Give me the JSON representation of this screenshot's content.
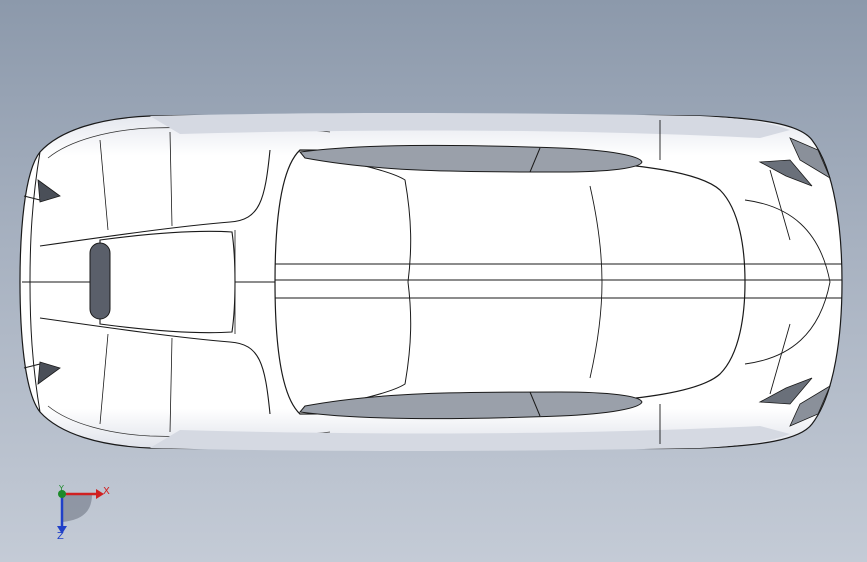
{
  "viewport": {
    "view": "top view",
    "colors": {
      "background_top": "#8c99ab",
      "background_bottom": "#c4cbd6",
      "body": "#ffffff",
      "edges": "#1a1a1a",
      "shade": "#c7ccd6",
      "glass": "#9aa0aa"
    }
  },
  "triad": {
    "x_label": "X",
    "y_label": "Y",
    "z_label": "Z",
    "x_color": "#d02020",
    "y_color": "#1c8a2a",
    "z_color": "#2040c8"
  }
}
